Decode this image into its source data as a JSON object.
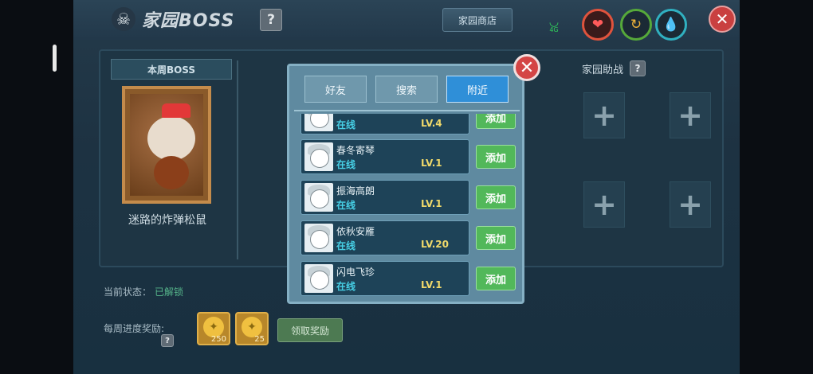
{
  "header": {
    "title": "家园BOSS",
    "help": "?",
    "shop_label": "家园商店",
    "wifi_label": "4G",
    "close": "✕"
  },
  "boss": {
    "section_label": "本周BOSS",
    "name": "迷路的炸弹松鼠"
  },
  "assist": {
    "title": "家园助战",
    "help": "?",
    "slots": [
      "+",
      "+",
      "+",
      "+"
    ]
  },
  "status": {
    "label": "当前状态：",
    "value": "已解锁"
  },
  "rewards": {
    "label": "每周进度奖励:",
    "help": "?",
    "items": [
      {
        "icon": "coin-icon",
        "amount": "250"
      },
      {
        "icon": "coin-icon",
        "amount": "25"
      }
    ],
    "claim_label": "领取奖励"
  },
  "dialog": {
    "tabs": [
      {
        "label": "好友",
        "active": false
      },
      {
        "label": "搜索",
        "active": false
      },
      {
        "label": "附近",
        "active": true
      }
    ],
    "close": "✕",
    "players": [
      {
        "name": "",
        "status": "在线",
        "level": "LV.4",
        "add_label": "添加"
      },
      {
        "name": "春冬寄琴",
        "status": "在线",
        "level": "LV.1",
        "add_label": "添加"
      },
      {
        "name": "振海高朗",
        "status": "在线",
        "level": "LV.1",
        "add_label": "添加"
      },
      {
        "name": "依秋安雁",
        "status": "在线",
        "level": "LV.20",
        "add_label": "添加"
      },
      {
        "name": "闪电飞珍",
        "status": "在线",
        "level": "LV.1",
        "add_label": "添加"
      }
    ]
  }
}
